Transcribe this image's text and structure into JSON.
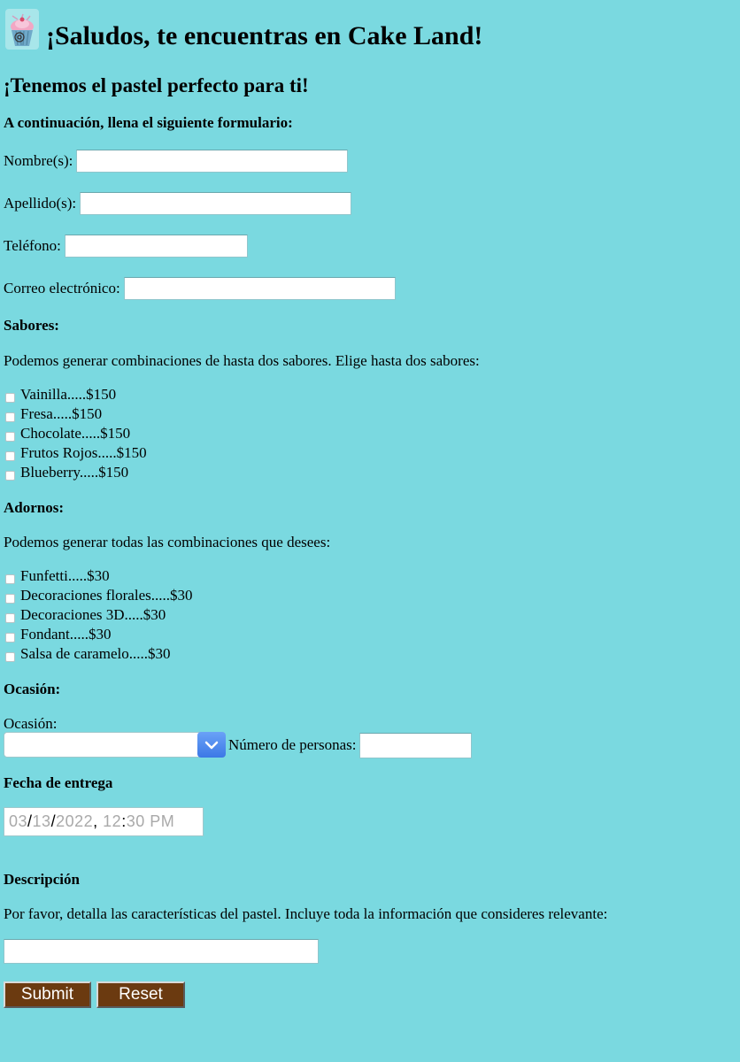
{
  "header": {
    "title": "¡Saludos, te encuentras en Cake Land!",
    "subtitle": "¡Tenemos el pastel perfecto para ti!",
    "logo_icon": "cupcake-logo-icon"
  },
  "form": {
    "intro": "A continuación, llena el siguiente formulario:",
    "fields": {
      "nombre": {
        "label": "Nombre(s):",
        "value": ""
      },
      "apellido": {
        "label": "Apellido(s):",
        "value": ""
      },
      "telefono": {
        "label": "Teléfono:",
        "value": ""
      },
      "correo": {
        "label": "Correo electrónico:",
        "value": ""
      }
    },
    "sabores": {
      "heading": "Sabores:",
      "description": "Podemos generar combinaciones de hasta dos sabores. Elige hasta dos sabores:",
      "options": [
        "Vainilla.....$150",
        "Fresa.....$150",
        "Chocolate.....$150",
        "Frutos Rojos.....$150",
        "Blueberry.....$150"
      ]
    },
    "adornos": {
      "heading": "Adornos:",
      "description": "Podemos generar todas las combinaciones que desees:",
      "options": [
        "Funfetti.....$30",
        "Decoraciones florales.....$30",
        "Decoraciones 3D.....$30",
        "Fondant.....$30",
        "Salsa de caramelo.....$30"
      ]
    },
    "ocasion": {
      "heading": "Ocasión:",
      "select_label": "Ocasión:",
      "selected_value": "",
      "personas_label": "Número de personas:",
      "personas_value": ""
    },
    "fecha": {
      "heading": "Fecha de entrega",
      "month": "03",
      "day": "13",
      "year": "2022",
      "hour": "12",
      "minute": "30",
      "ampm": "PM"
    },
    "descripcion": {
      "heading": "Descripción",
      "instructions": "Por favor, detalla las características del pastel. Incluye toda la información que consideres relevante:",
      "value": ""
    },
    "buttons": {
      "submit": "Submit",
      "reset": "Reset"
    }
  },
  "colors": {
    "background": "#7ad9e0",
    "button_bg": "#6b3a10",
    "select_arrow": "#3c78e6"
  }
}
